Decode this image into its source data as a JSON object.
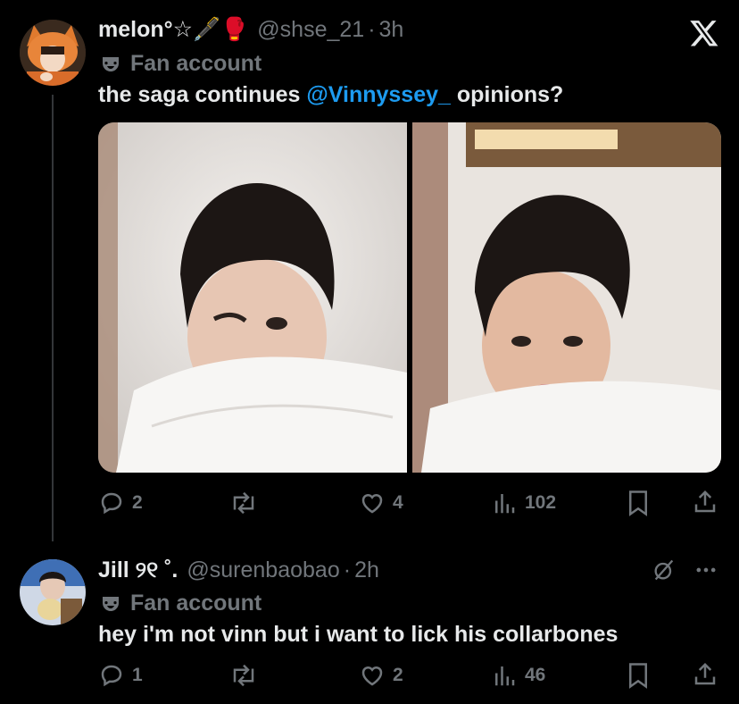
{
  "tweet1": {
    "display_name": "melon°☆🖋️🥊",
    "handle": "@shse_21",
    "separator": "·",
    "time": "3h",
    "label": "Fan account",
    "text_before": "the saga continues",
    "mention": "@Vinnyssey_",
    "text_after": "opinions?",
    "stats": {
      "replies": "2",
      "retweets": "",
      "likes": "4",
      "views": "102"
    }
  },
  "tweet2": {
    "display_name": "Jill ୨୧ ˚.",
    "handle": "@surenbaobao",
    "separator": "·",
    "time": "2h",
    "label": "Fan account",
    "text": "hey i'm not vinn but i want to lick his collarbones",
    "stats": {
      "replies": "1",
      "retweets": "",
      "likes": "2",
      "views": "46"
    }
  },
  "icons": {
    "close": "x-logo-icon",
    "label": "theater-mask-icon",
    "reply": "comment-icon",
    "retweet": "retweet-icon",
    "like": "heart-icon",
    "views": "bar-chart-icon",
    "bookmark": "bookmark-icon",
    "share": "share-icon",
    "grok": "grok-icon",
    "more": "more-dots-icon"
  },
  "colors": {
    "background": "#000000",
    "text": "#e7e9ea",
    "muted": "#71767b",
    "accent": "#1d9bf0"
  }
}
